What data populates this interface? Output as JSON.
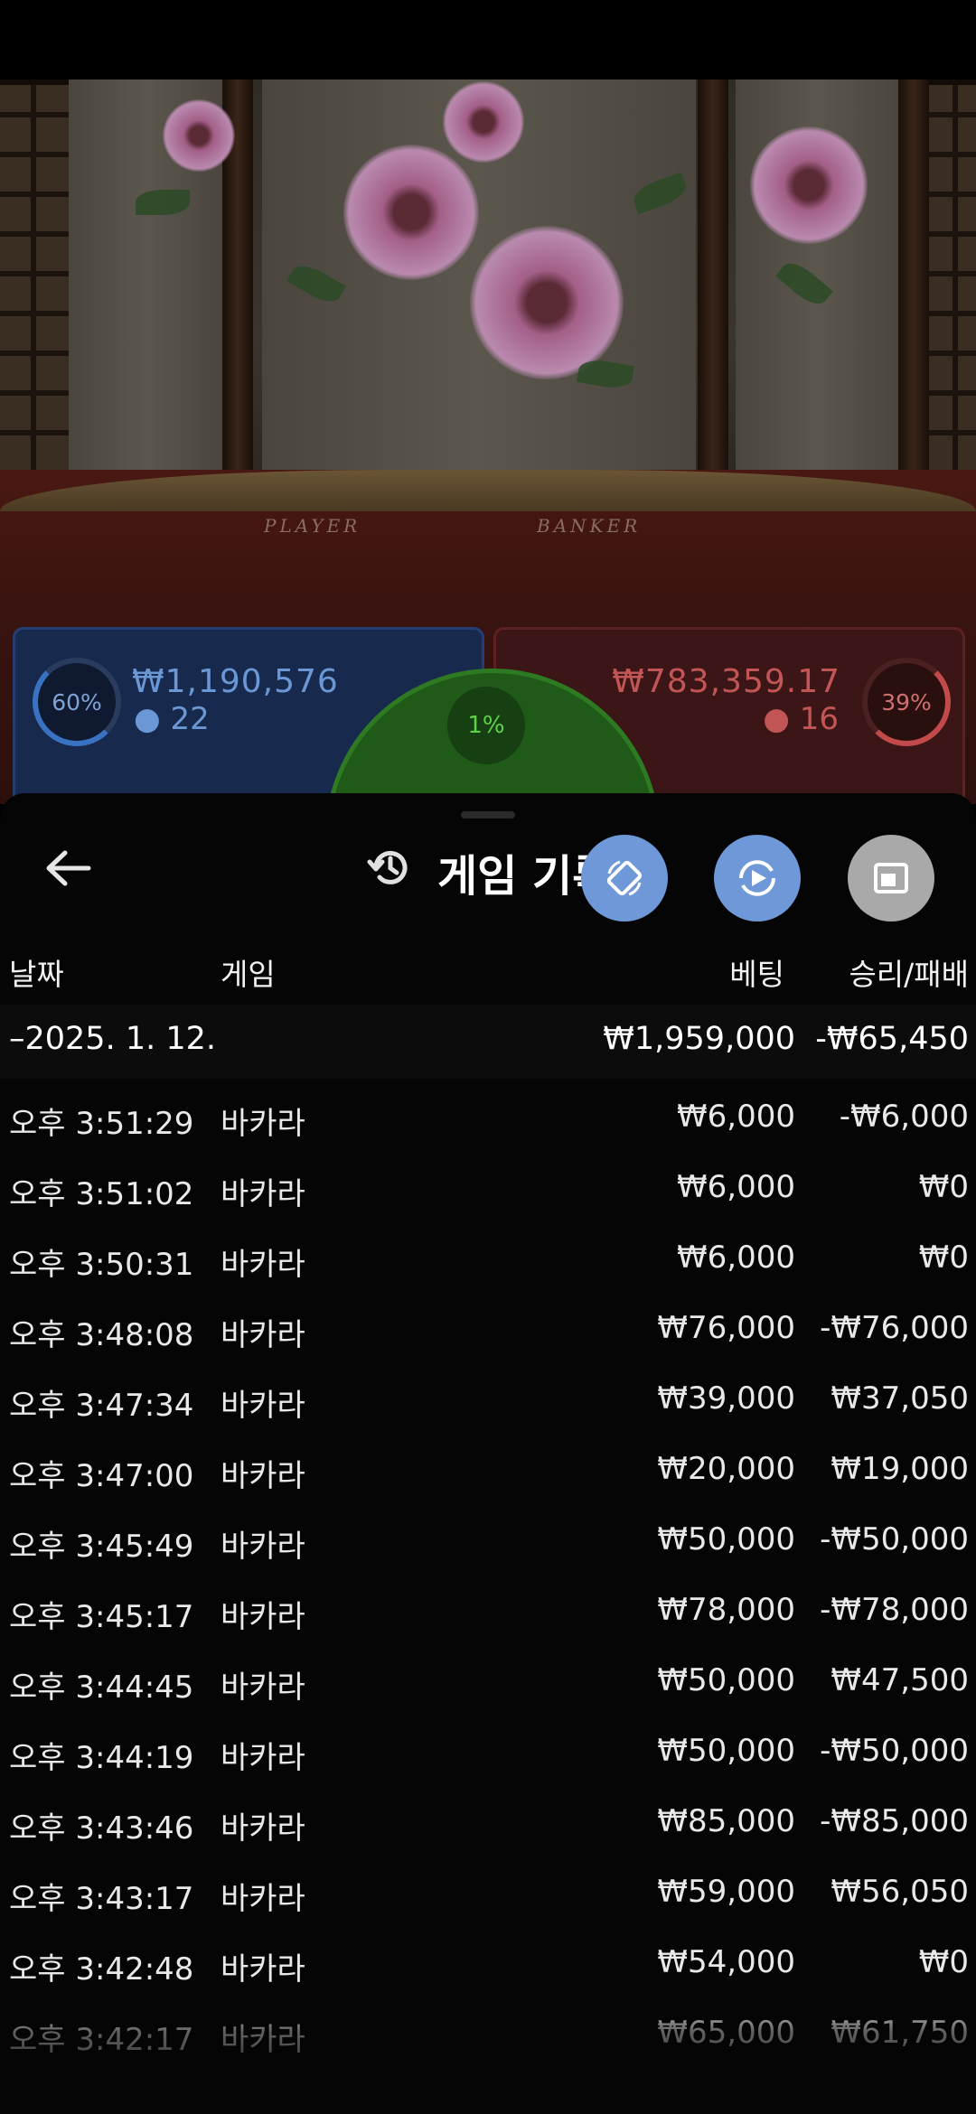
{
  "scene": {
    "table_player_word": "PLAYER",
    "table_banker_word": "BANKER"
  },
  "stats": {
    "player_percent": "60%",
    "player_amount": "₩1,190,576",
    "player_count": "22",
    "tie_percent": "1%",
    "banker_amount": "₩783,359.17",
    "banker_count": "16",
    "banker_percent": "39%"
  },
  "sheet": {
    "back_icon": "arrow-left-icon",
    "title_icon": "history-icon",
    "title": "게임 기록",
    "actions": [
      {
        "icon": "rotate-screen-icon"
      },
      {
        "icon": "replay-icon"
      },
      {
        "icon": "picture-in-picture-icon"
      }
    ],
    "columns": {
      "date": "날짜",
      "game": "게임",
      "bet": "베팅",
      "result": "승리/패배"
    },
    "day": {
      "date": "–2025. 1. 12.",
      "bet_total": "₩1,959,000",
      "result_total": "-₩65,450"
    },
    "rows": [
      {
        "time": "오후 3:51:29",
        "game": "바카라",
        "bet": "₩6,000",
        "result": "-₩6,000"
      },
      {
        "time": "오후 3:51:02",
        "game": "바카라",
        "bet": "₩6,000",
        "result": "₩0"
      },
      {
        "time": "오후 3:50:31",
        "game": "바카라",
        "bet": "₩6,000",
        "result": "₩0"
      },
      {
        "time": "오후 3:48:08",
        "game": "바카라",
        "bet": "₩76,000",
        "result": "-₩76,000"
      },
      {
        "time": "오후 3:47:34",
        "game": "바카라",
        "bet": "₩39,000",
        "result": "₩37,050"
      },
      {
        "time": "오후 3:47:00",
        "game": "바카라",
        "bet": "₩20,000",
        "result": "₩19,000"
      },
      {
        "time": "오후 3:45:49",
        "game": "바카라",
        "bet": "₩50,000",
        "result": "-₩50,000"
      },
      {
        "time": "오후 3:45:17",
        "game": "바카라",
        "bet": "₩78,000",
        "result": "-₩78,000"
      },
      {
        "time": "오후 3:44:45",
        "game": "바카라",
        "bet": "₩50,000",
        "result": "₩47,500"
      },
      {
        "time": "오후 3:44:19",
        "game": "바카라",
        "bet": "₩50,000",
        "result": "-₩50,000"
      },
      {
        "time": "오후 3:43:46",
        "game": "바카라",
        "bet": "₩85,000",
        "result": "-₩85,000"
      },
      {
        "time": "오후 3:43:17",
        "game": "바카라",
        "bet": "₩59,000",
        "result": "₩56,050"
      },
      {
        "time": "오후 3:42:48",
        "game": "바카라",
        "bet": "₩54,000",
        "result": "₩0"
      },
      {
        "time": "오후 3:42:17",
        "game": "바카라",
        "bet": "₩65,000",
        "result": "₩61,750"
      }
    ]
  }
}
